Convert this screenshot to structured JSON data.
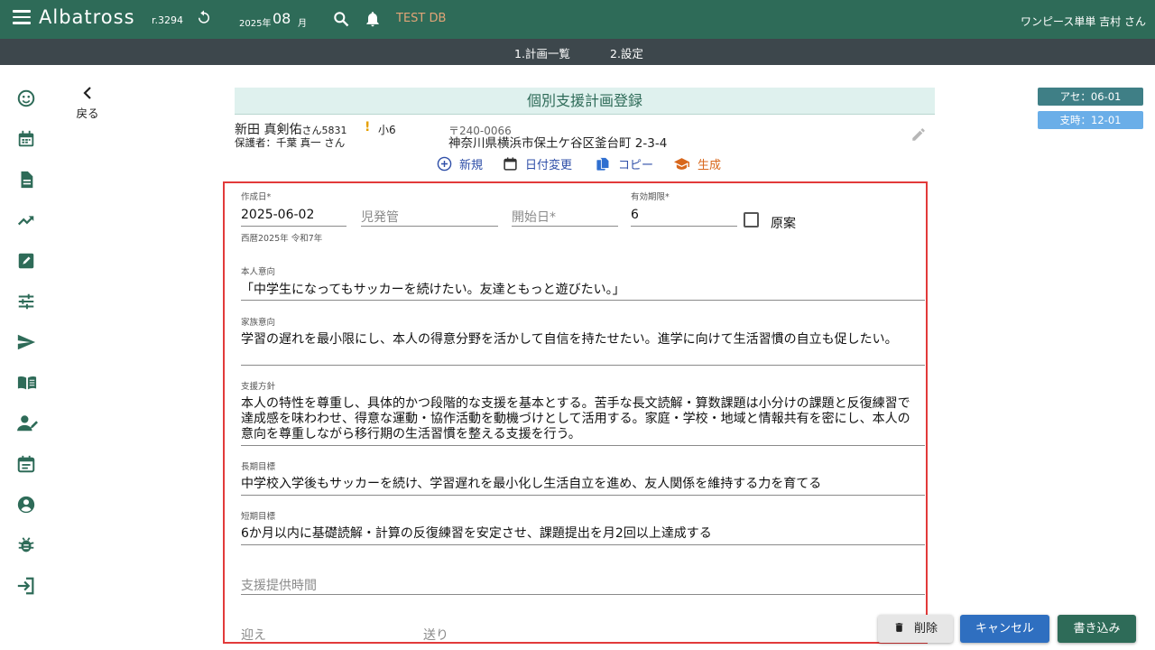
{
  "header": {
    "app_title": "Albatross",
    "revision": "r.3294",
    "date_year": "2025年",
    "date_month": "08",
    "date_unit": "月",
    "db_label": "TEST DB",
    "user_label": "ワンピース単単 吉村 さん"
  },
  "nav": {
    "items": [
      {
        "label": "1.計画一覧"
      },
      {
        "label": "2.設定"
      }
    ]
  },
  "sidebar": {
    "icons": [
      "smiley-icon",
      "calendar-icon",
      "document-icon",
      "trending-up-icon",
      "edit-note-icon",
      "sliders-icon",
      "send-icon",
      "book-icon",
      "person-edit-icon",
      "event-note-icon",
      "account-circle-icon",
      "bug-icon",
      "login-icon"
    ]
  },
  "back": {
    "label": "戻る"
  },
  "card": {
    "title": "個別支援計画登録",
    "student_name": "新田 真剣佑",
    "honorific": "さん",
    "student_id": "5831",
    "warn": "!",
    "grade": "小6",
    "guardian": "保護者：千葉 真一 さん",
    "postal": "〒240-0066",
    "address": "神奈川県横浜市保土ケ谷区釜台町 2-3-4"
  },
  "actions": {
    "new": "新規",
    "date_change": "日付変更",
    "copy": "コピー",
    "generate": "生成"
  },
  "colors": {
    "topbar": "#2e6b58",
    "navbar": "#3d474c",
    "accent_blue": "#2f4fa8",
    "generate_orange": "#d8671c",
    "highlight_red": "#e23a3a"
  },
  "form": {
    "created_label": "作成日*",
    "created_value": "2025-06-02",
    "created_hint": "西暦2025年 令和7年",
    "manager_placeholder": "児発管",
    "start_placeholder": "開始日*",
    "validity_label": "有効期限*",
    "validity_value": "6",
    "draft_label": "原案",
    "intent_self_label": "本人意向",
    "intent_self": "「中学生になってもサッカーを続けたい。友達ともっと遊びたい。」",
    "intent_family_label": "家族意向",
    "intent_family": "学習の遅れを最小限にし、本人の得意分野を活かして自信を持たせたい。進学に向けて生活習慣の自立も促したい。",
    "policy_label": "支援方針",
    "policy": "本人の特性を尊重し、具体的かつ段階的な支援を基本とする。苦手な長文読解・算数課題は小分けの課題と反復練習で達成感を味わわせ、得意な運動・協作活動を動機づけとして活用する。家庭・学校・地域と情報共有を密にし、本人の意向を尊重しながら移行期の生活習慣を整える支援を行う。",
    "long_goal_label": "長期目標",
    "long_goal": "中学校入学後もサッカーを続け、学習遅れを最小化し生活自立を進め、友人関係を維持する力を育てる",
    "short_goal_label": "短期目標",
    "short_goal": "6か月以内に基礎読解・計算の反復練習を安定させ、課題提出を月2回以上達成する",
    "support_time_placeholder": "支援提供時間",
    "pickup_placeholder": "迎え",
    "dropoff_placeholder": "送り"
  },
  "badges": {
    "a": "アセ：06-01",
    "b": "支時：12-01"
  },
  "buttons": {
    "delete": "削除",
    "cancel": "キャンセル",
    "save": "書き込み"
  }
}
